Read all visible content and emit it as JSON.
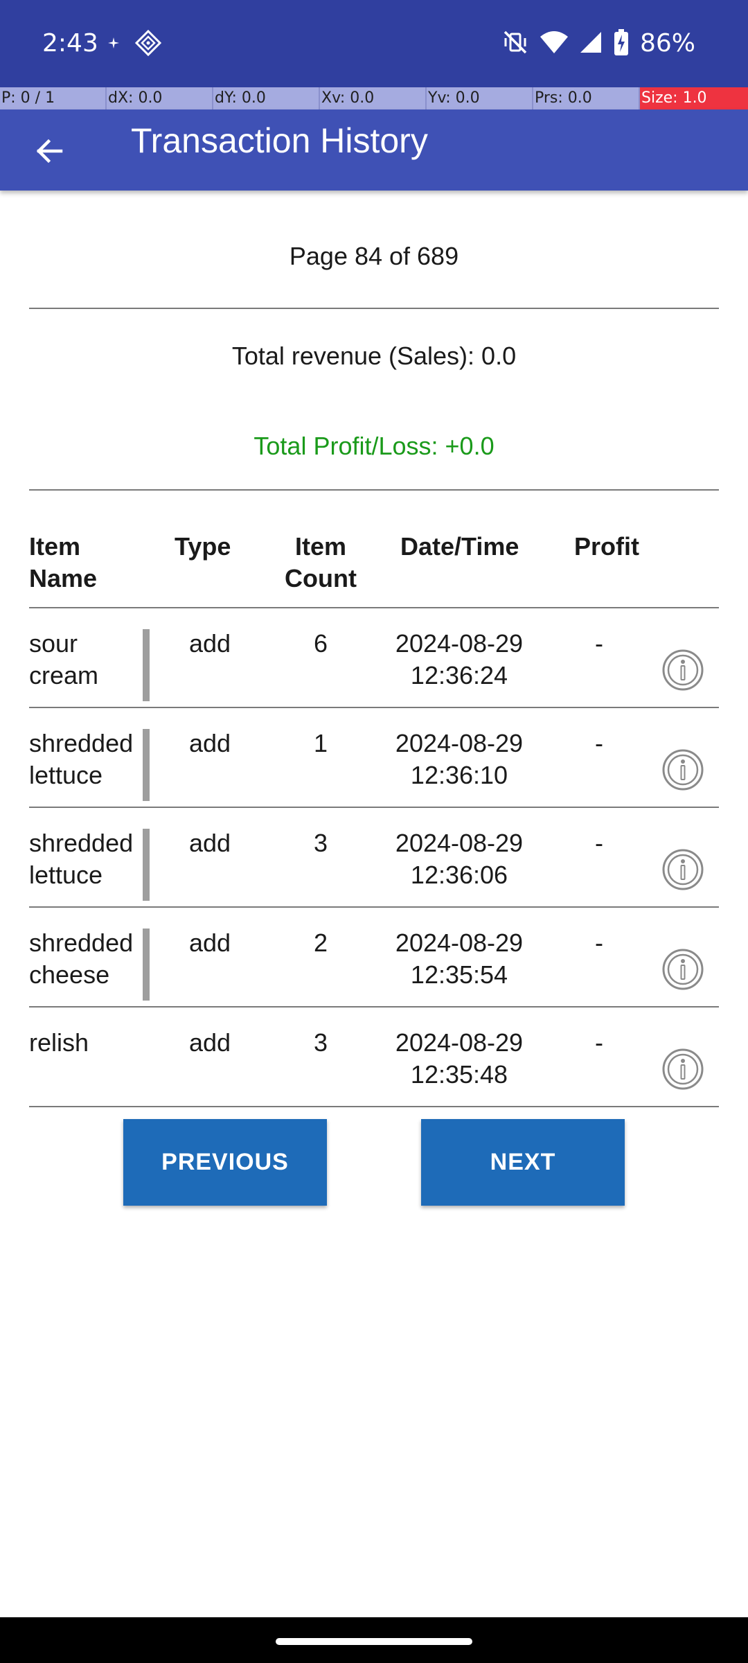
{
  "status_bar": {
    "time": "2:43",
    "battery": "86%",
    "icons": [
      "sparkle-icon",
      "diamond-app-icon",
      "mute-vibrate-icon",
      "wifi-icon",
      "signal-icon",
      "battery-charging-icon"
    ]
  },
  "pointer_info": {
    "p": "P: 0 / 1",
    "dx": "dX: 0.0",
    "dy": "dY: 0.0",
    "xv": "Xv: 0.0",
    "yv": "Yv: 0.0",
    "prs": "Prs: 0.0",
    "size": "Size: 1.0"
  },
  "app_bar": {
    "title": "Transaction History",
    "back_icon": "arrow-back-icon"
  },
  "summary": {
    "page": "Page 84 of 689",
    "revenue": "Total revenue (Sales): 0.0",
    "profit": "Total Profit/Loss: +0.0"
  },
  "colors": {
    "status_bar": "#303f9f",
    "app_bar": "#3f51b5",
    "profit_text": "#1a9a1a",
    "button": "#1e6bb8"
  },
  "table": {
    "headers": {
      "name_1": "Item",
      "name_2": "Name",
      "type": "Type",
      "count_1": "Item",
      "count_2": "Count",
      "date": "Date/Time",
      "profit": "Profit"
    },
    "rows": [
      {
        "name_1": "sour",
        "name_2": "cream",
        "type": "add",
        "count": "6",
        "date": "2024-08-29",
        "time": "12:36:24",
        "profit": "-",
        "has_bar": true
      },
      {
        "name_1": "shredded",
        "name_2": "lettuce",
        "type": "add",
        "count": "1",
        "date": "2024-08-29",
        "time": "12:36:10",
        "profit": "-",
        "has_bar": true
      },
      {
        "name_1": "shredded",
        "name_2": "lettuce",
        "type": "add",
        "count": "3",
        "date": "2024-08-29",
        "time": "12:36:06",
        "profit": "-",
        "has_bar": true
      },
      {
        "name_1": "shredded",
        "name_2": "cheese",
        "type": "add",
        "count": "2",
        "date": "2024-08-29",
        "time": "12:35:54",
        "profit": "-",
        "has_bar": true
      },
      {
        "name_1": "relish",
        "name_2": "",
        "type": "add",
        "count": "3",
        "date": "2024-08-29",
        "time": "12:35:48",
        "profit": "-",
        "has_bar": false
      }
    ]
  },
  "buttons": {
    "previous": "PREVIOUS",
    "next": "NEXT"
  }
}
